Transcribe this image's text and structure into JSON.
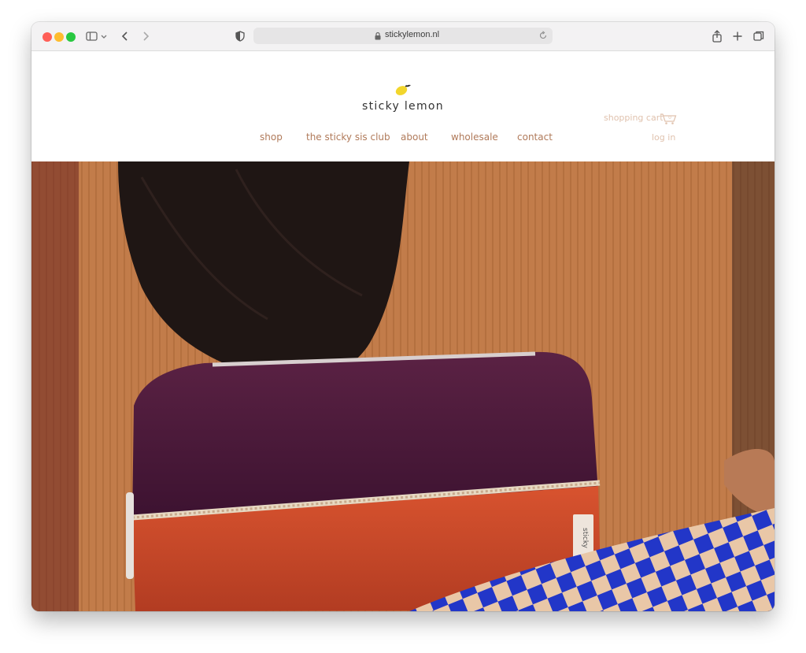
{
  "browser": {
    "url": "stickylemon.nl"
  },
  "site": {
    "logo_text": "sticky lemon",
    "nav": [
      "shop",
      "the sticky sis club",
      "about",
      "wholesale",
      "contact"
    ],
    "cart_label": "shopping cart",
    "cart_count": "0",
    "login_label": "log in"
  },
  "hero": {
    "bag_tag": "sticky"
  },
  "colors": {
    "nav_text": "#b07a5a",
    "muted_text": "#e0c2ae",
    "lemon": "#f2d62c",
    "bag_purple": "#4e1a3a",
    "bag_orange": "#cf4a2c",
    "checker_blue": "#2236c8",
    "sweater": "#c47f4d"
  }
}
